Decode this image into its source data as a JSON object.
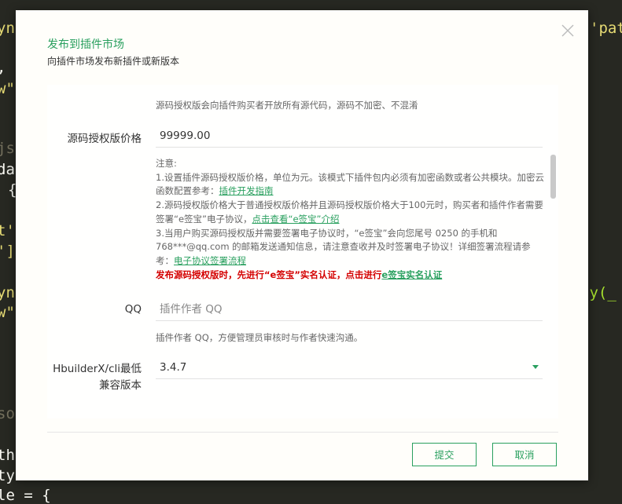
{
  "background_code": {
    "left_fragments": [
      "yn",
      ",",
      "w\"",
      "js",
      "da",
      "{",
      "t'",
      "']",
      "yn",
      "w\"",
      "so",
      "th",
      "ty",
      "le"
    ],
    "right_fragments": [
      "'pat",
      "fy(_"
    ],
    "bottom_line": "le = {"
  },
  "dialog": {
    "title": "发布到插件市场",
    "subtitle": "向插件市场发布新插件或新版本",
    "source_hint": "源码授权版会向插件购买者开放所有源代码，源码不加密、不混淆",
    "price": {
      "label": "源码授权版价格",
      "value": "99999.00"
    },
    "notes": {
      "heading": "注意:",
      "line1": "1.设置插件源码授权版价格，单位为元。该模式下插件包内必须有加密函数或者公共模块。加密云函数配置参考：",
      "line1_link": "插件开发指南",
      "line2": "2.源码授权版价格大于普通授权版价格并且源码授权版价格大于100元时，购买者和插件作者需要签署“e签宝”电子协议，",
      "line2_link": "点击查看“e签宝”介绍",
      "line3": "3.当用户购买源码授权版并需要签署电子协议时，“e签宝”会向您尾号 0250 的手机和 768***@qq.com 的邮箱发送通知信息，请注意查收并及时签署电子协议！详细签署流程请参考：",
      "line3_link": "电子协议签署流程",
      "warning": "发布源码授权版时，先进行“e签宝”实名认证，点击进行",
      "warning_link": "e签宝实名认证"
    },
    "qq": {
      "label": "QQ",
      "placeholder": "插件作者 QQ",
      "hint": "插件作者 QQ，方便管理员审核时与作者快速沟通。"
    },
    "hbuilder": {
      "label_line1": "HbuilderX/cli最低",
      "label_line2": "兼容版本",
      "value": "3.4.7"
    },
    "submit_label": "提交",
    "cancel_label": "取消"
  },
  "colors": {
    "accent": "#2aa05f",
    "warning": "#d40000",
    "editor_bg": "#272822"
  }
}
